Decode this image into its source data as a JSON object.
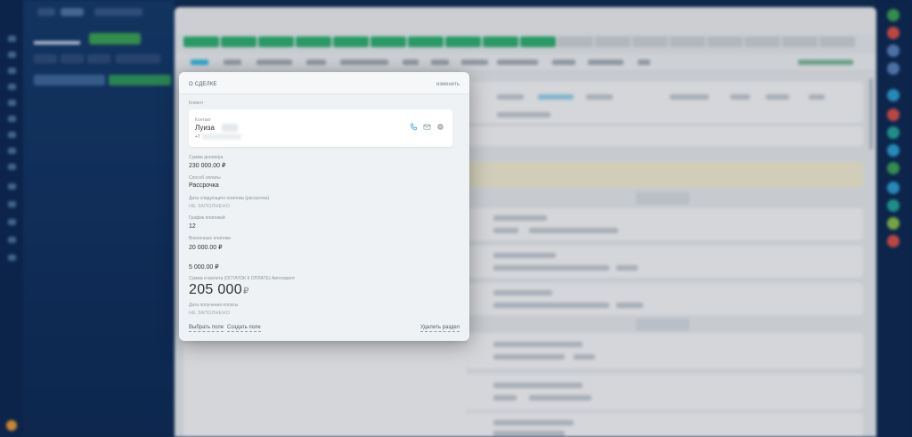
{
  "deal_section": {
    "title": "О СДЕЛКЕ",
    "edit_label": "изменить",
    "client": {
      "section_label": "Клиент",
      "contact_label": "Контакт",
      "contact_name": "Луиза",
      "phone_prefix": "+7",
      "icons": [
        "phone-icon",
        "mail-icon",
        "chat-icon"
      ]
    },
    "fields": {
      "contract_sum_label": "Сумма договора",
      "contract_sum_value": "230 000.00 ₽",
      "payment_method_label": "Способ оплаты",
      "payment_method_value": "Рассрочка",
      "next_payment_date_label": "Дата следующего платежа (рассрочка)",
      "next_payment_date_value": "НЕ ЗАПОЛНЕНО",
      "payment_schedule_label": "График платежей",
      "payment_schedule_value": "12",
      "paid_amount_label": "Внесенные платежи",
      "paid_amount_value": "20 000.00 ₽",
      "extra_amount_value": "5 000.00 ₽",
      "remaining_label": "Сумма и валюта (ОСТАТОК К ОПЛАТЕ) Автоскрипт",
      "remaining_value": "205 000",
      "remaining_currency": "₽",
      "payment_received_date_label": "Дата получения оплаты",
      "payment_received_date_value": "НЕ ЗАПОЛНЕНО"
    },
    "footer": {
      "select_field": "Выбрать поле",
      "create_field": "Создать поле",
      "delete_section": "Удалить раздел"
    }
  },
  "colors": {
    "background": "#0d2a52",
    "stage_green": "#2bb673",
    "accent_blue": "#2fc6f6"
  }
}
